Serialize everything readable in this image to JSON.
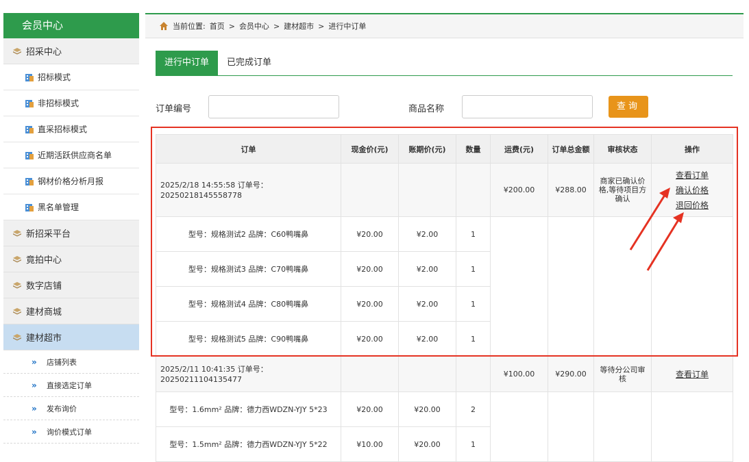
{
  "sidebar": {
    "title": "会员中心",
    "cat1": "招采中心",
    "subs": [
      "招标模式",
      "非招标模式",
      "直采招标模式",
      "近期活跃供应商名单",
      "钢材价格分析月报",
      "黑名单管理"
    ],
    "cats": [
      "新招采平台",
      "竟拍中心",
      "数字店铺",
      "建材商城"
    ],
    "active_cat": "建材超市",
    "links": [
      "店铺列表",
      "直接选定订单",
      "发布询价",
      "询价模式订单"
    ]
  },
  "breadcrumb": {
    "label": "当前位置:",
    "items": [
      "首页",
      ">",
      "会员中心",
      ">",
      "建材超市",
      ">",
      "进行中订单"
    ]
  },
  "tabs": {
    "active": "进行中订单",
    "inactive": "已完成订单"
  },
  "filter": {
    "order_no_label": "订单编号",
    "order_no_value": "",
    "product_label": "商品名称",
    "product_value": "",
    "query_button": "查询"
  },
  "table": {
    "headers": [
      "订单",
      "现金价(元)",
      "账期价(元)",
      "数量",
      "运费(元)",
      "订单总金额",
      "审核状态",
      "操作"
    ],
    "order1": {
      "summary": "2025/2/18 14:55:58    订单号：20250218145558778",
      "freight": "¥200.00",
      "total": "¥288.00",
      "status": "商家已确认价格,等待项目方确认",
      "actions": [
        "查看订单",
        "确认价格",
        "退回价格"
      ],
      "items": [
        {
          "model": "型号：规格测试2    品牌：C60鸭嘴鼻",
          "cash": "¥20.00",
          "credit": "¥2.00",
          "qty": "1"
        },
        {
          "model": "型号：规格测试3    品牌：C70鸭嘴鼻",
          "cash": "¥20.00",
          "credit": "¥2.00",
          "qty": "1"
        },
        {
          "model": "型号：规格测试4    品牌：C80鸭嘴鼻",
          "cash": "¥20.00",
          "credit": "¥2.00",
          "qty": "1"
        },
        {
          "model": "型号：规格测试5    品牌：C90鸭嘴鼻",
          "cash": "¥20.00",
          "credit": "¥2.00",
          "qty": "1"
        }
      ]
    },
    "order2": {
      "summary": "2025/2/11 10:41:35    订单号：20250211104135477",
      "freight": "¥100.00",
      "total": "¥290.00",
      "status": "等待分公司审核",
      "actions": [
        "查看订单"
      ],
      "items": [
        {
          "model": "型号：1.6mm²    品牌：德力西WDZN-YJY 5*23",
          "cash": "¥20.00",
          "credit": "¥20.00",
          "qty": "2"
        },
        {
          "model": "型号：1.5mm²    品牌：德力西WDZN-YJY 5*22",
          "cash": "¥10.00",
          "credit": "¥20.00",
          "qty": "1"
        }
      ]
    }
  },
  "colors": {
    "brand_green": "#2e9b4c",
    "query_orange": "#e8941a",
    "highlight_red": "#e53222",
    "active_blue": "#c7ddf1"
  },
  "icons": [
    "diamond-icon",
    "building-icon",
    "double-chevron-icon",
    "home-icon",
    "red-arrow-annotation"
  ]
}
